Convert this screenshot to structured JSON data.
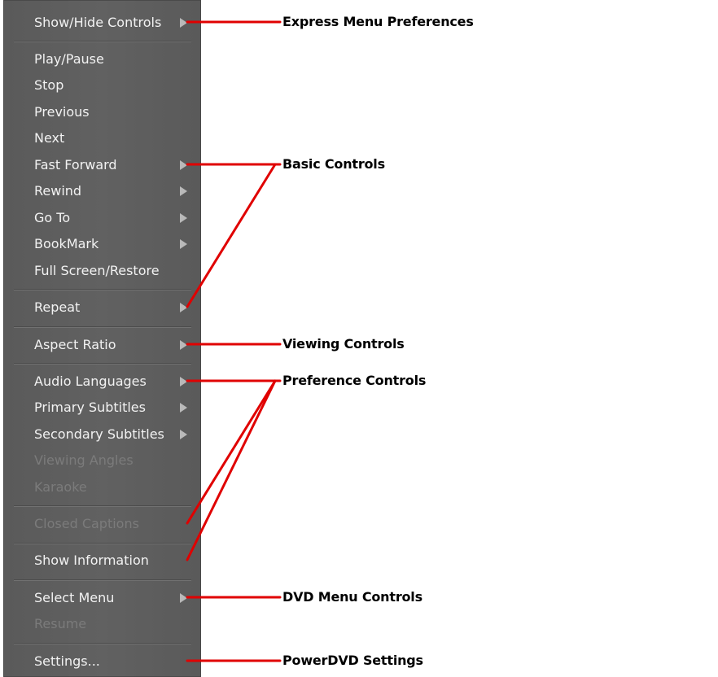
{
  "menu": {
    "show_hide_controls": "Show/Hide Controls",
    "play_pause": "Play/Pause",
    "stop": "Stop",
    "previous": "Previous",
    "next": "Next",
    "fast_forward": "Fast Forward",
    "rewind": "Rewind",
    "go_to": "Go To",
    "bookmark": "BookMark",
    "full_screen_restore": "Full Screen/Restore",
    "repeat": "Repeat",
    "aspect_ratio": "Aspect Ratio",
    "audio_languages": "Audio Languages",
    "primary_subtitles": "Primary Subtitles",
    "secondary_subtitles": "Secondary Subtitles",
    "viewing_angles": "Viewing Angles",
    "karaoke": "Karaoke",
    "closed_captions": "Closed Captions",
    "show_information": "Show Information",
    "select_menu": "Select Menu",
    "resume": "Resume",
    "settings": "Settings..."
  },
  "annotations": {
    "express_menu_preferences": "Express Menu Preferences",
    "basic_controls": "Basic Controls",
    "viewing_controls": "Viewing Controls",
    "preference_controls": "Preference Controls",
    "dvd_menu_controls": "DVD Menu Controls",
    "powerdvd_settings": "PowerDVD Settings"
  },
  "colors": {
    "menu_background": "#5e5e5e",
    "menu_text": "#f2f2f2",
    "disabled_text": "#7b7b7b",
    "callout_line": "#e00000"
  }
}
